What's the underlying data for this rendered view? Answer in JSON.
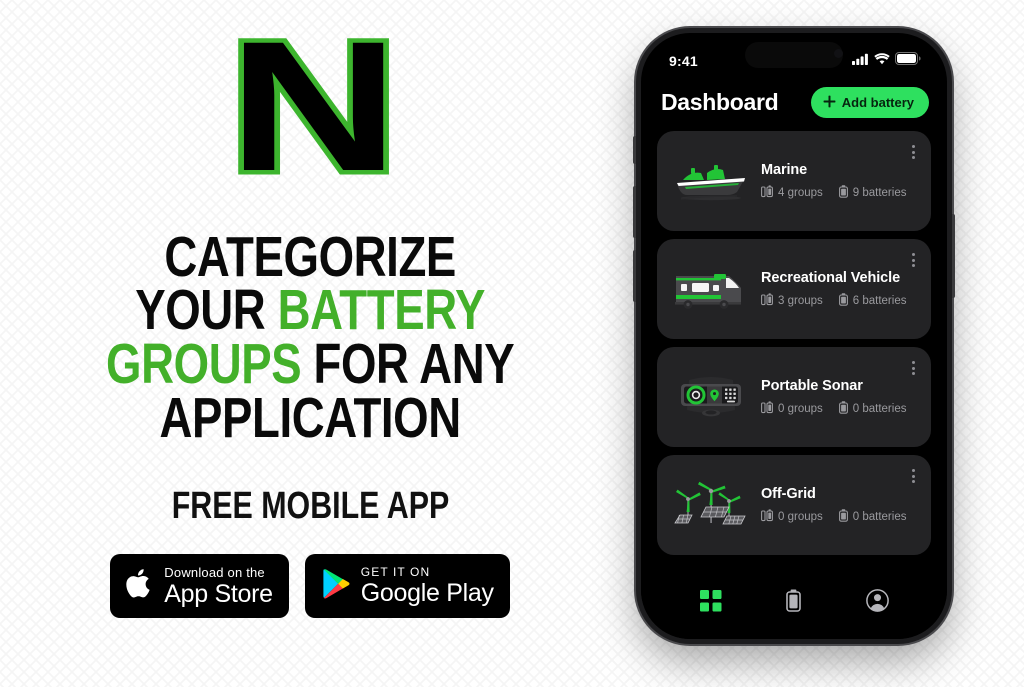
{
  "brand": {
    "logo_letter": "N",
    "accent_green": "#43b02a",
    "app_green": "#2ee05f"
  },
  "promo": {
    "headline_lines": [
      {
        "parts": [
          {
            "text": "CATEGORIZE",
            "green": false
          }
        ]
      },
      {
        "parts": [
          {
            "text": "YOUR ",
            "green": false
          },
          {
            "text": "BATTERY",
            "green": true
          }
        ]
      },
      {
        "parts": [
          {
            "text": "GROUPS",
            "green": true
          },
          {
            "text": " FOR ANY",
            "green": false
          }
        ]
      },
      {
        "parts": [
          {
            "text": "APPLICATION",
            "green": false
          }
        ]
      }
    ],
    "subhead": "FREE MOBILE APP",
    "badges": [
      {
        "icon": "apple-icon",
        "top_label": "Download on the",
        "bottom_label": "App Store"
      },
      {
        "icon": "google-play-icon",
        "top_label": "GET IT ON",
        "bottom_label": "Google Play"
      }
    ]
  },
  "phone": {
    "status_bar": {
      "time": "9:41",
      "icons": [
        "cellular-signal-icon",
        "wifi-icon",
        "battery-icon"
      ]
    },
    "app": {
      "title": "Dashboard",
      "add_button": {
        "label": "Add battery",
        "icon": "plus-icon"
      },
      "cards": [
        {
          "title": "Marine",
          "icon": "boat-icon",
          "groups_label": "4 groups",
          "batteries_label": "9 batteries",
          "menu_icon": "kebab-menu-icon"
        },
        {
          "title": "Recreational Vehicle",
          "icon": "rv-icon",
          "groups_label": "3 groups",
          "batteries_label": "6 batteries",
          "menu_icon": "kebab-menu-icon"
        },
        {
          "title": "Portable Sonar",
          "icon": "sonar-icon",
          "groups_label": "0 groups",
          "batteries_label": "0 batteries",
          "menu_icon": "kebab-menu-icon"
        },
        {
          "title": "Off-Grid",
          "icon": "renewable-energy-icon",
          "groups_label": "0 groups",
          "batteries_label": "0 batteries",
          "menu_icon": "kebab-menu-icon"
        }
      ],
      "tabs": [
        {
          "name": "dashboard",
          "icon": "grid-icon",
          "active": true
        },
        {
          "name": "batteries",
          "icon": "battery-icon",
          "active": false
        },
        {
          "name": "account",
          "icon": "profile-icon",
          "active": false
        }
      ]
    }
  }
}
